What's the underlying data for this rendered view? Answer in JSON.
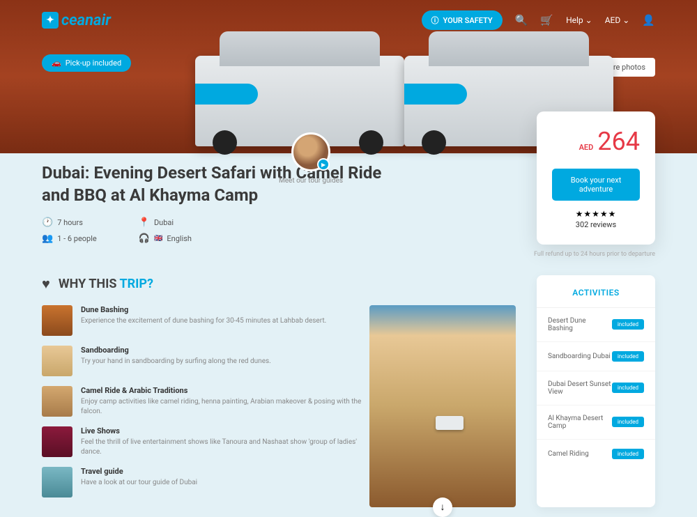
{
  "logo": "ceanair",
  "nav": {
    "safety": "YOUR SAFETY",
    "help": "Help",
    "currency": "AED"
  },
  "badges": {
    "pickup": "Pick-up included",
    "morePhotos": "More photos"
  },
  "title": "Dubai: Evening Desert Safari with Camel Ride and BBQ at Al Khayma Camp",
  "guide": {
    "text": "Meet our tour guides"
  },
  "meta": {
    "duration": "7 hours",
    "location": "Dubai",
    "group": "1 - 6 people",
    "language": "English"
  },
  "price": {
    "currency": "AED",
    "amount": "264",
    "bookBtn": "Book your next adventure",
    "stars": "★★★★★",
    "reviews": "302 reviews",
    "refund": "Full refund up to 24 hours prior to departure"
  },
  "why": {
    "heading1": "WHY THIS",
    "heading2": "TRIP?",
    "items": [
      {
        "title": "Dune Bashing",
        "desc": "Experience the excitement of dune bashing for 30-45 minutes at Lahbab desert."
      },
      {
        "title": "Sandboarding",
        "desc": "Try your hand in sandboarding by surfing along the red dunes."
      },
      {
        "title": "Camel Ride & Arabic Traditions",
        "desc": "Enjoy camp activities like camel riding, henna painting, Arabian makeover & posing with the falcon."
      },
      {
        "title": "Live Shows",
        "desc": "Feel the thrill of live entertainment shows like Tanoura and Nashaat show 'group of ladies' dance."
      },
      {
        "title": "Travel guide",
        "desc": "Have a look at our tour guide of  Dubai"
      }
    ]
  },
  "activities": {
    "heading": "ACTIVITIES",
    "items": [
      {
        "name": "Desert Dune Bashing",
        "badge": "included"
      },
      {
        "name": "Sandboarding Dubai",
        "badge": "included"
      },
      {
        "name": "Dubai Desert Sunset View",
        "badge": "included"
      },
      {
        "name": "Al Khayma Desert Camp",
        "badge": "included"
      },
      {
        "name": "Camel Riding",
        "badge": "included"
      }
    ]
  }
}
